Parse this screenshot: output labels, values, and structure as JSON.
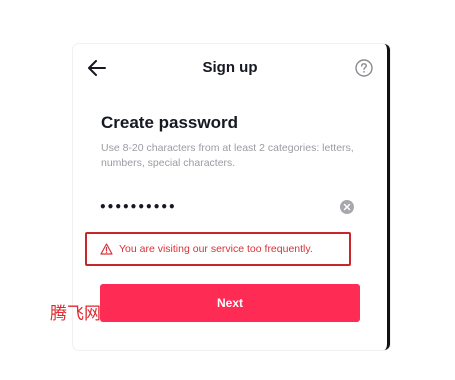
{
  "header": {
    "title": "Sign up",
    "back_icon": "arrow-left-icon",
    "help_icon": "question-circle-icon"
  },
  "form": {
    "heading": "Create password",
    "hint": "Use 8-20 characters from at least 2 categories: letters, numbers, special characters.",
    "password_value": "••••••••••",
    "clear_icon": "clear-circle-icon"
  },
  "error": {
    "icon": "warning-triangle-icon",
    "message": "You are visiting our service too frequently."
  },
  "actions": {
    "next_label": "Next"
  },
  "watermark": {
    "text": "腾飞网"
  },
  "colors": {
    "accent": "#fe2c55",
    "error": "#c8262b",
    "text": "#161823",
    "hint": "#9a9ca3"
  }
}
